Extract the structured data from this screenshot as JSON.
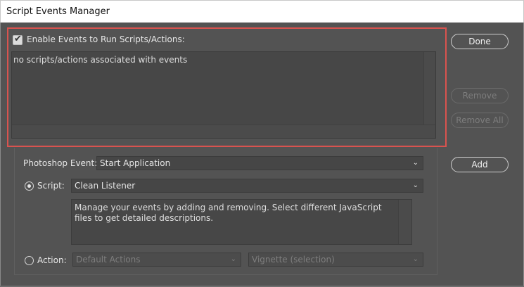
{
  "window": {
    "title": "Script Events Manager"
  },
  "events_group": {
    "enable_label": "Enable Events to Run Scripts/Actions:",
    "enable_checked": true,
    "list_empty_text": "no scripts/actions associated with events"
  },
  "buttons": {
    "done": "Done",
    "remove": "Remove",
    "remove_all": "Remove All",
    "add": "Add"
  },
  "form": {
    "photoshop_event_label": "Photoshop Event:",
    "photoshop_event_value": "Start Application",
    "script_label": "Script:",
    "script_value": "Clean Listener",
    "script_selected": true,
    "description": "Manage your events by adding and removing. Select different JavaScript files to get detailed descriptions.",
    "action_label": "Action:",
    "action_set_value": "Default Actions",
    "action_value": "Vignette (selection)"
  },
  "colors": {
    "highlight_border": "#d9534f",
    "dialog_background": "#535353"
  },
  "icons": {
    "checkbox": "check-icon",
    "dropdown": "chevron-down-icon"
  }
}
